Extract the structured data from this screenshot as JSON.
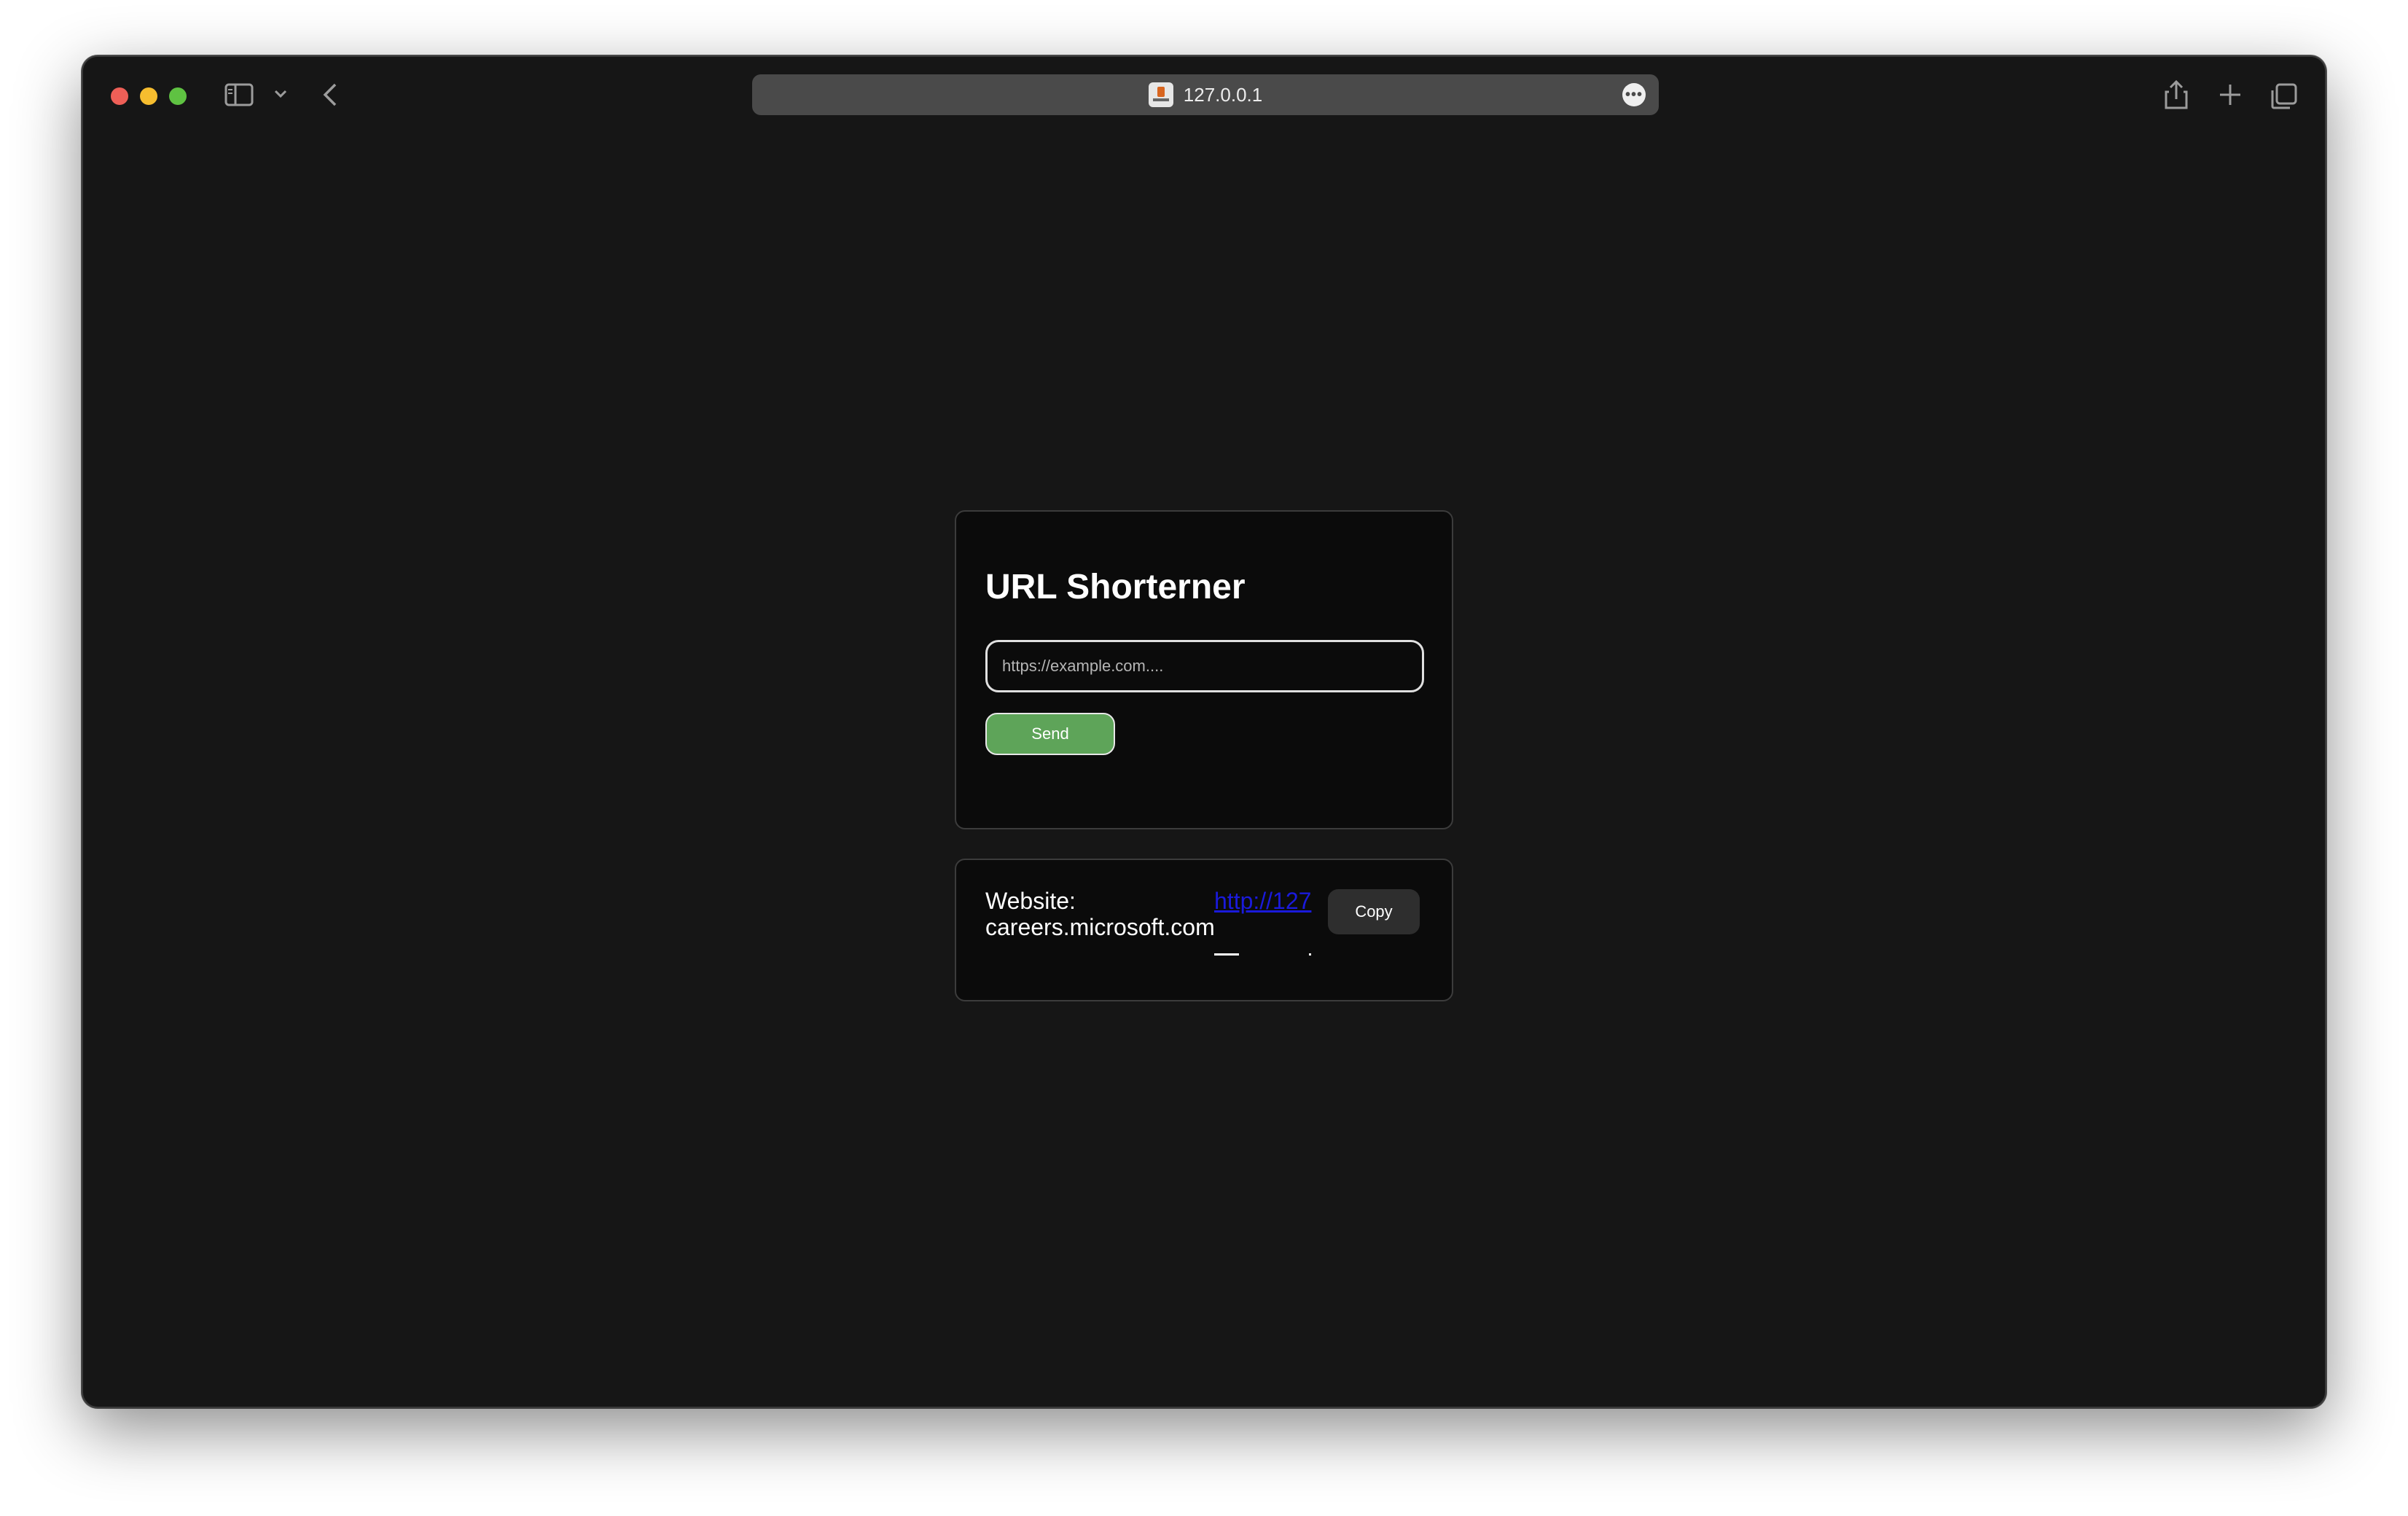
{
  "browser": {
    "address": "127.0.0.1"
  },
  "app": {
    "title": "URL Shorterner",
    "input_placeholder": "https://example.com....",
    "send_label": "Send"
  },
  "result": {
    "website_label": "Website: careers.microsoft.com",
    "short_link": "http://127",
    "copy_label": "Copy"
  },
  "colors": {
    "background": "#161616",
    "card": "#0b0b0b",
    "send_button": "#5ea459",
    "link": "#1a1adb",
    "copy_button": "#2e2e2e"
  }
}
